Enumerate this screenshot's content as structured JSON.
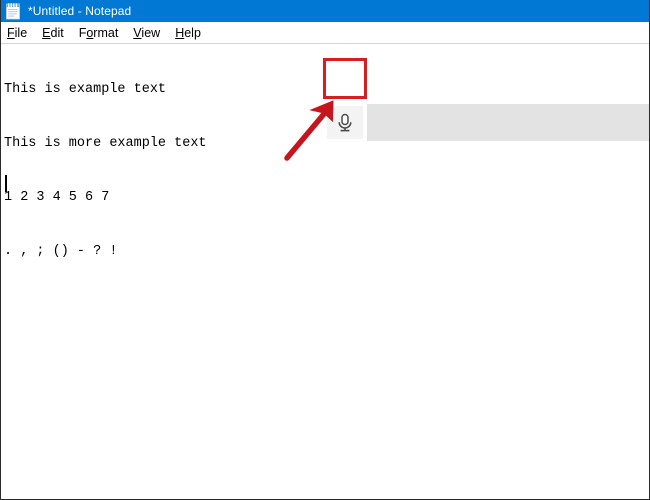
{
  "window": {
    "title": "*Untitled - Notepad",
    "app_icon": "notepad-icon",
    "titlebar_color": "#0078d4"
  },
  "menubar": {
    "items": [
      {
        "label": "File",
        "accelerator": "F",
        "rest": "ile"
      },
      {
        "label": "Edit",
        "accelerator": "E",
        "rest": "dit"
      },
      {
        "label": "Format",
        "pre": "F",
        "accelerator": "o",
        "rest": "rmat"
      },
      {
        "label": "View",
        "accelerator": "V",
        "rest": "iew"
      },
      {
        "label": "Help",
        "accelerator": "H",
        "rest": "elp"
      }
    ]
  },
  "document": {
    "lines": [
      "This is example text",
      "This is more example text",
      "1 2 3 4 5 6 7",
      ". , ; () - ? !",
      "",
      ""
    ],
    "caret_line": 6,
    "modified": true
  },
  "dictation": {
    "mic_button_label": "microphone",
    "mic_icon": "microphone-icon",
    "band_color": "#e3e3e3",
    "button_background": "#f3f3f3"
  },
  "annotations": {
    "highlight_color": "#d81f1f",
    "arrow_color": "#c4161c",
    "highlight_target": "mic-button",
    "arrow_direction": "up-right"
  }
}
